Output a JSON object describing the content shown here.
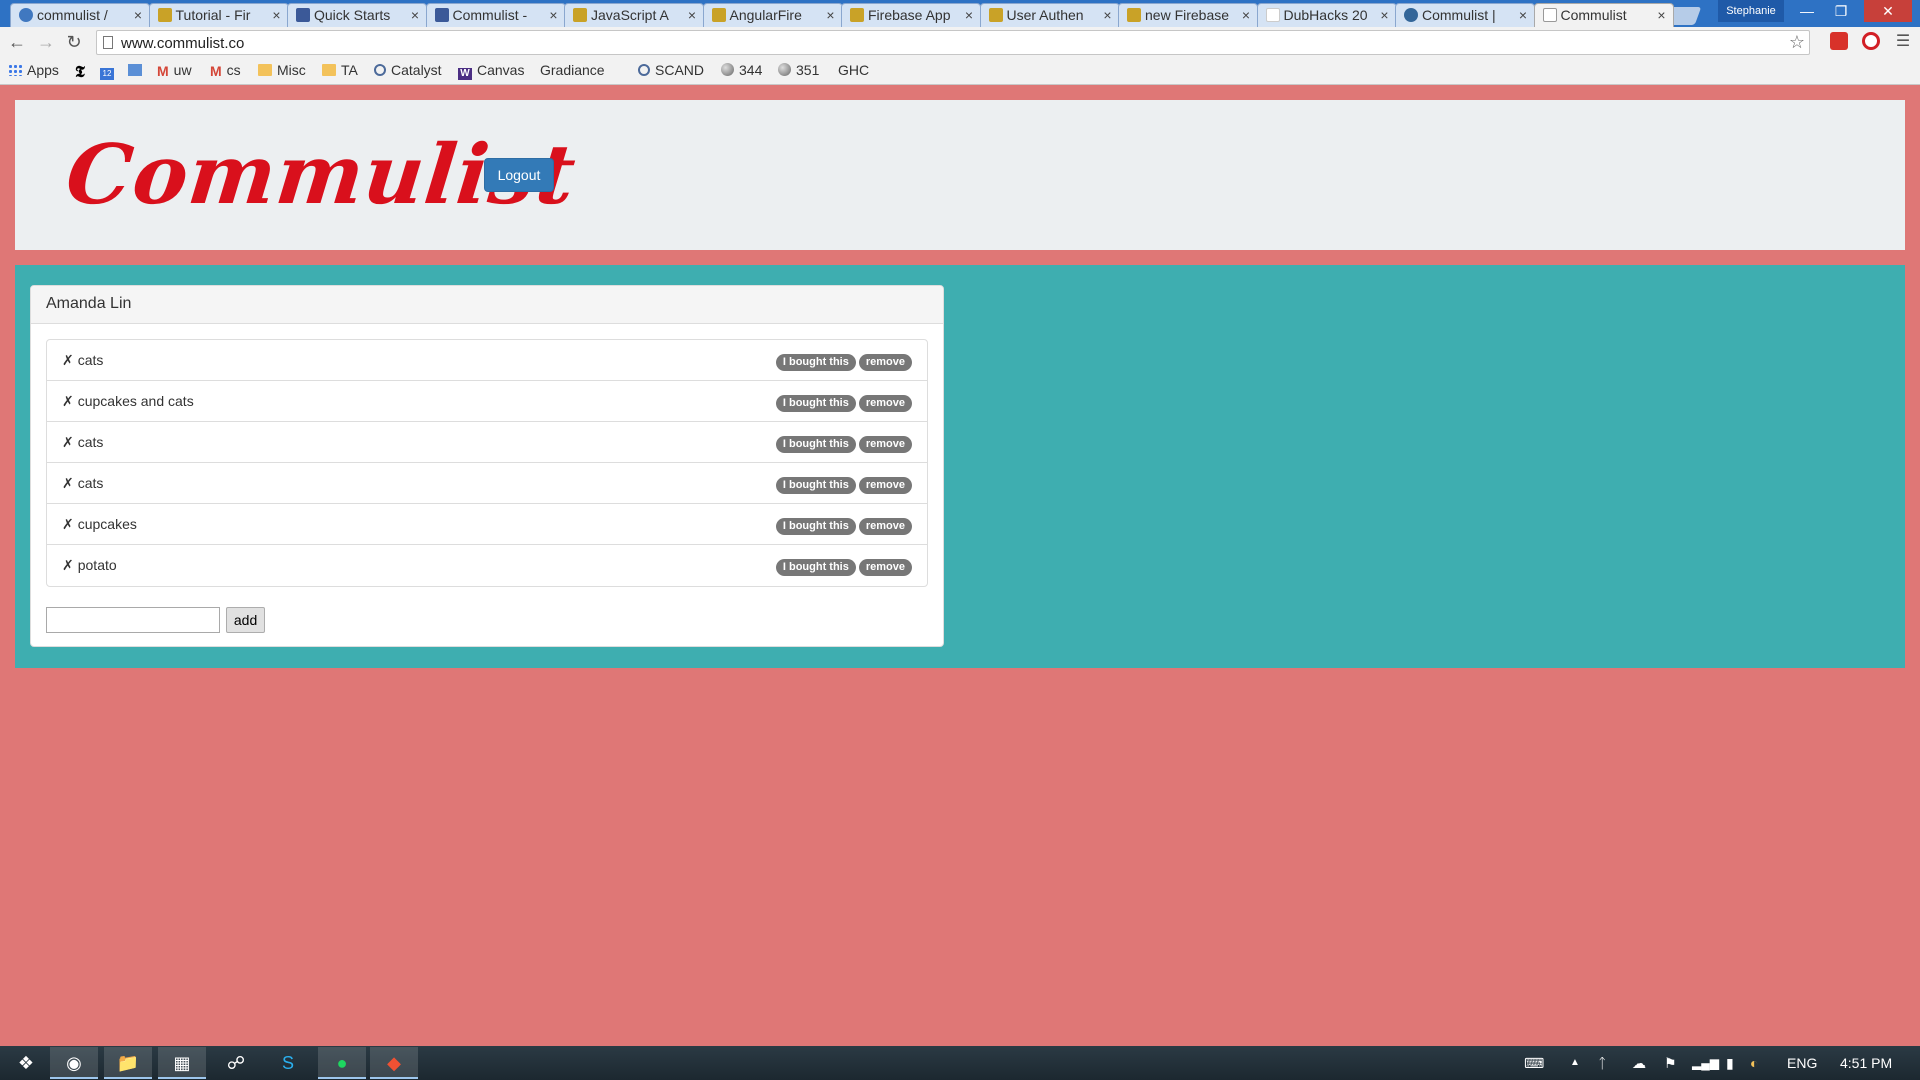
{
  "browser": {
    "tabs": [
      {
        "title": "commulist /",
        "icon": "github-icon",
        "kind": "gh"
      },
      {
        "title": "Tutorial - Fir",
        "icon": "database-icon",
        "kind": "db"
      },
      {
        "title": "Quick Starts",
        "icon": "facebook-icon",
        "kind": "fb"
      },
      {
        "title": "Commulist -",
        "icon": "facebook-icon",
        "kind": "fb"
      },
      {
        "title": "JavaScript A",
        "icon": "database-icon",
        "kind": "db"
      },
      {
        "title": "AngularFire",
        "icon": "database-icon",
        "kind": "db"
      },
      {
        "title": "Firebase App",
        "icon": "database-icon",
        "kind": "db"
      },
      {
        "title": "User Authen",
        "icon": "database-icon",
        "kind": "db"
      },
      {
        "title": "new Firebase",
        "icon": "database-icon",
        "kind": "db"
      },
      {
        "title": "DubHacks 20",
        "icon": "gmail-icon",
        "kind": "gm"
      },
      {
        "title": "Commulist |",
        "icon": "digitalocean-icon",
        "kind": "dg"
      },
      {
        "title": "Commulist",
        "icon": "page-icon",
        "kind": "pg",
        "active": true
      }
    ],
    "profile_name": "Stephanie",
    "url": "www.commulist.co",
    "bookmarks": [
      {
        "label": "Apps",
        "icon": "apps-grid-icon",
        "kind": "grid"
      },
      {
        "label": "",
        "icon": "nyt-icon",
        "kind": "nyt"
      },
      {
        "label": "",
        "icon": "calendar-icon",
        "kind": "cal"
      },
      {
        "label": "",
        "icon": "mail-icon",
        "kind": "mail"
      },
      {
        "label": "uw",
        "icon": "gmail-icon",
        "kind": "gmail"
      },
      {
        "label": "cs",
        "icon": "gmail-icon",
        "kind": "gmail"
      },
      {
        "label": "Misc",
        "icon": "folder-icon",
        "kind": "folder"
      },
      {
        "label": "TA",
        "icon": "folder-icon",
        "kind": "folder"
      },
      {
        "label": "Catalyst",
        "icon": "catalyst-icon",
        "kind": "ring"
      },
      {
        "label": "Canvas",
        "icon": "uw-icon",
        "kind": "uw"
      },
      {
        "label": "Gradiance",
        "icon": "page-icon",
        "kind": "page"
      },
      {
        "label": "SCAND",
        "icon": "catalyst-icon",
        "kind": "ring"
      },
      {
        "label": "344",
        "icon": "ball-icon",
        "kind": "ball"
      },
      {
        "label": "351",
        "icon": "ball-icon",
        "kind": "ball"
      },
      {
        "label": "GHC",
        "icon": "page-icon",
        "kind": "page"
      }
    ]
  },
  "app": {
    "logo_text": "Commulist",
    "logout_label": "Logout",
    "list_owner": "Amanda Lin",
    "item_prefix": "✗",
    "bought_label": "I bought this",
    "remove_label": "remove",
    "items": [
      {
        "name": "cats"
      },
      {
        "name": "cupcakes and cats"
      },
      {
        "name": "cats"
      },
      {
        "name": "cats"
      },
      {
        "name": "cupcakes"
      },
      {
        "name": "potato"
      }
    ],
    "add_input_value": "",
    "add_label": "add",
    "colors": {
      "page_bg": "#df7776",
      "header_bg": "#eceff1",
      "panel_bg": "#3eaeb0",
      "logo": "#d9101c",
      "logout_btn": "#337ab7",
      "badge": "#777777"
    }
  },
  "taskbar": {
    "apps": [
      "windows-start-icon",
      "chrome-icon",
      "file-explorer-icon",
      "sublime-icon",
      "network-icon",
      "skype-icon",
      "spotify-icon",
      "git-icon"
    ],
    "language": "ENG",
    "clock": "4:51 PM"
  }
}
